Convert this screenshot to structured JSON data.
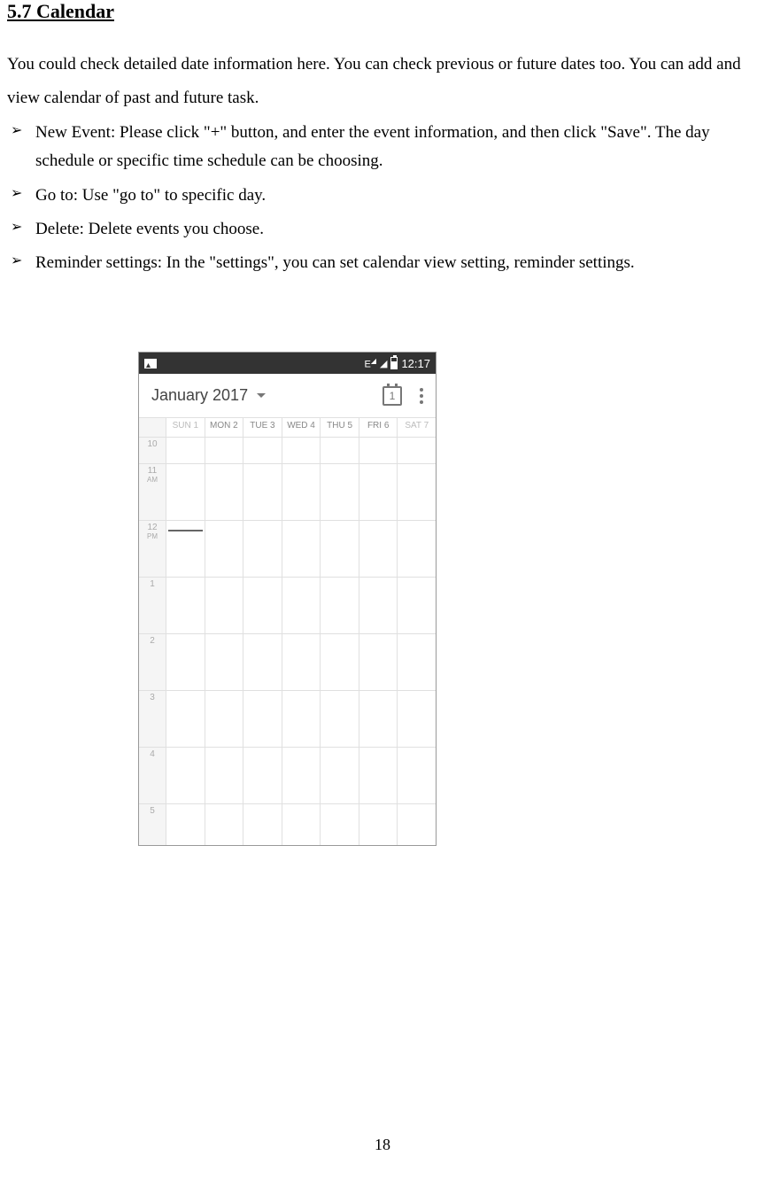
{
  "heading": "5.7 Calendar",
  "intro": "You could check detailed date information here. You can check previous or future dates too. You can add and view calendar of past and future task.",
  "bullets": [
    "New Event: Please click \"+\" button, and enter the event information, and then click \"Save\". The day schedule or specific time schedule can be choosing.",
    "Go to: Use \"go to\" to specific day.",
    "Delete: Delete events you choose.",
    "Reminder settings: In the \"settings\", you can set calendar view setting, reminder settings."
  ],
  "phone": {
    "statusBar": {
      "signal": "E",
      "time": "12:17"
    },
    "header": {
      "month": "January 2017",
      "todayNum": "1"
    },
    "days": [
      {
        "abbr": "SUN",
        "num": "1",
        "inactive": true
      },
      {
        "abbr": "MON",
        "num": "2"
      },
      {
        "abbr": "TUE",
        "num": "3"
      },
      {
        "abbr": "WED",
        "num": "4"
      },
      {
        "abbr": "THU",
        "num": "5"
      },
      {
        "abbr": "FRI",
        "num": "6"
      },
      {
        "abbr": "SAT",
        "num": "7",
        "inactive": true
      }
    ],
    "hours": [
      {
        "label": "10",
        "sub": ""
      },
      {
        "label": "11",
        "sub": "AM"
      },
      {
        "label": "12",
        "sub": "PM",
        "current": true
      },
      {
        "label": "1",
        "sub": ""
      },
      {
        "label": "2",
        "sub": ""
      },
      {
        "label": "3",
        "sub": ""
      },
      {
        "label": "4",
        "sub": ""
      },
      {
        "label": "5",
        "sub": ""
      }
    ]
  },
  "pageNumber": "18"
}
